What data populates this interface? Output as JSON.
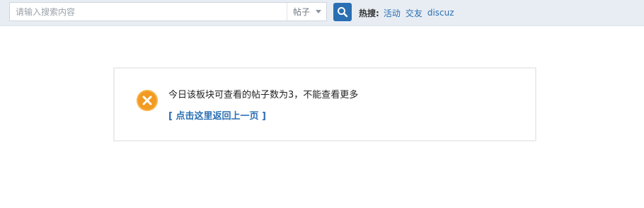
{
  "search": {
    "placeholder": "请输入搜索内容",
    "type_label": "帖子",
    "icons": {
      "search": "search-icon",
      "dropdown": "chevron-down-icon"
    }
  },
  "hot_search": {
    "label": "热搜:",
    "links": [
      "活动",
      "交友",
      "discuz"
    ]
  },
  "message": {
    "text": "今日该板块可查看的帖子数为3，不能查看更多",
    "back_link": "[ 点击这里返回上一页 ]",
    "icon": "error-x-icon"
  },
  "colors": {
    "accent": "#2a6fb3",
    "error": "#f29a21",
    "topbar": "#e8edf3"
  }
}
